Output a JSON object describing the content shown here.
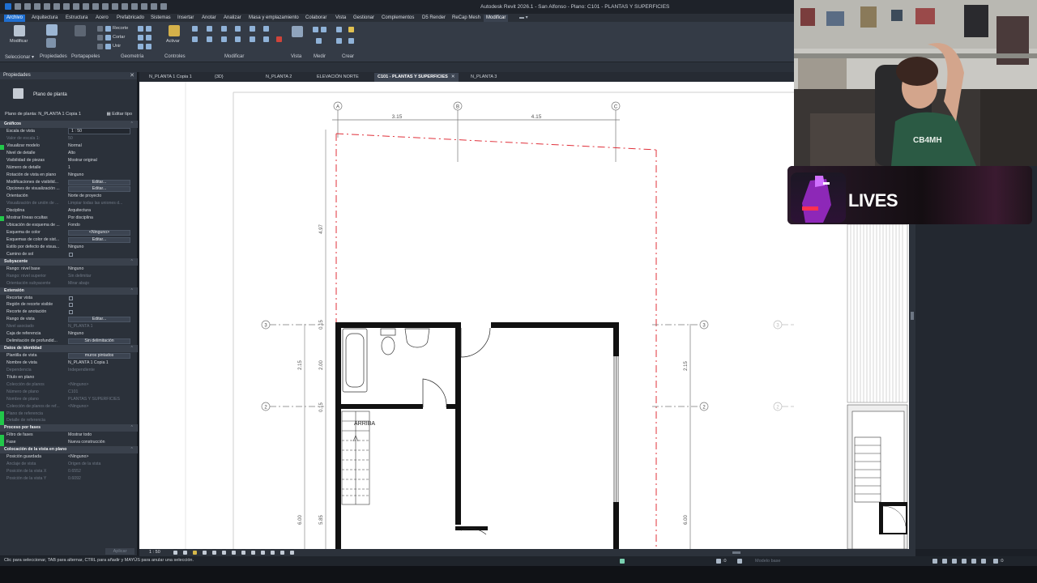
{
  "window": {
    "title": "Autodesk Revit 2026.1 - San Alfonso - Plano: C101 - PLANTAS Y SUPERFICIES"
  },
  "menu": {
    "items": [
      "Archivo",
      "Arquitectura",
      "Estructura",
      "Acero",
      "Prefabricado",
      "Sistemas",
      "Insertar",
      "Anotar",
      "Analizar",
      "Masa y emplazamiento",
      "Colaborar",
      "Vista",
      "Gestionar",
      "Complementos",
      "D5 Render",
      "ReCap Mesh",
      "Modificar"
    ]
  },
  "ribbon": {
    "groups": [
      "Seleccionar",
      "Propiedades",
      "Portapapeles",
      "Geometría",
      "Controles",
      "Modificar",
      "Vista",
      "Medir",
      "Crear"
    ],
    "buttons": {
      "modify": "Modificar",
      "activate": "Activar",
      "cope": "Recorte",
      "cut": "Cortar",
      "join": "Unir"
    }
  },
  "properties": {
    "title": "Propiedades",
    "type_name": "Plano de planta",
    "instance_label": "Plano de planta: N_PLANTA 1 Copia 1",
    "edit_type": "Editar tipo",
    "rows": [
      {
        "kind": "section",
        "name": "Gráficos"
      },
      {
        "name": "Escala de vista",
        "value": "1 : 50",
        "ctl": "box"
      },
      {
        "name": "Valor de escala   1:",
        "value": "50",
        "dim": true
      },
      {
        "name": "Visualizar modelo",
        "value": "Normal"
      },
      {
        "name": "Nivel de detalle",
        "value": "Alto"
      },
      {
        "name": "Visibilidad de piezas",
        "value": "Mostrar original"
      },
      {
        "name": "Número de detalle",
        "value": "1"
      },
      {
        "name": "Rotación de vista en plano",
        "value": "Ninguno"
      },
      {
        "name": "Modificaciones de visibilid...",
        "value": "Editar...",
        "ctl": "btn"
      },
      {
        "name": "Opciones de visualización ...",
        "value": "Editar...",
        "ctl": "btn"
      },
      {
        "name": "Orientación",
        "value": "Norte de proyecto"
      },
      {
        "name": "Visualización de unión de ...",
        "value": "Limpiar todas las uniones d...",
        "dim": true
      },
      {
        "name": "Disciplina",
        "value": "Arquitectura"
      },
      {
        "name": "Mostrar líneas ocultas",
        "value": "Por disciplina"
      },
      {
        "name": "Ubicación de esquema de ...",
        "value": "Fondo"
      },
      {
        "name": "Esquema de color",
        "value": "<Ninguno>",
        "ctl": "btn"
      },
      {
        "name": "Esquemas de color de sist...",
        "value": "Editar...",
        "ctl": "btn"
      },
      {
        "name": "Estilo por defecto de visua...",
        "value": "Ninguno"
      },
      {
        "name": "Camino de sol",
        "value": "",
        "ctl": "check"
      },
      {
        "kind": "section",
        "name": "Subyacente"
      },
      {
        "name": "Rango: nivel base",
        "value": "Ninguno"
      },
      {
        "name": "Rango: nivel superior",
        "value": "Sin delimitar",
        "dim": true
      },
      {
        "name": "Orientación subyacente",
        "value": "Mirar abajo",
        "dim": true
      },
      {
        "kind": "section",
        "name": "Extensión"
      },
      {
        "name": "Recortar vista",
        "value": "",
        "ctl": "check"
      },
      {
        "name": "Región de recorte visible",
        "value": "",
        "ctl": "check"
      },
      {
        "name": "Recorte de anotación",
        "value": "",
        "ctl": "check"
      },
      {
        "name": "Rango de vista",
        "value": "Editar...",
        "ctl": "btn"
      },
      {
        "name": "Nivel asociado",
        "value": "N_PLANTA 1",
        "dim": true
      },
      {
        "name": "Caja de referencia",
        "value": "Ninguno"
      },
      {
        "name": "Delimitación de profundid...",
        "value": "Sin delimitación",
        "ctl": "btn"
      },
      {
        "kind": "section",
        "name": "Datos de identidad"
      },
      {
        "name": "Plantilla de vista",
        "value": "muros pintados",
        "ctl": "btn"
      },
      {
        "name": "Nombre de vista",
        "value": "N_PLANTA 1 Copia 1"
      },
      {
        "name": "Dependencia",
        "value": "Independiente",
        "dim": true
      },
      {
        "name": "Título en plano",
        "value": ""
      },
      {
        "name": "Colección de planos",
        "value": "<Ninguno>",
        "dim": true
      },
      {
        "name": "Número de plano",
        "value": "C101",
        "dim": true
      },
      {
        "name": "Nombre de plano",
        "value": "PLANTAS Y SUPERFICIES",
        "dim": true
      },
      {
        "name": "Colección de planos de ref...",
        "value": "<Ninguno>",
        "dim": true
      },
      {
        "name": "Plano de referencia",
        "value": "",
        "dim": true
      },
      {
        "name": "Detalle de referencia",
        "value": "",
        "dim": true
      },
      {
        "kind": "section",
        "name": "Proceso por fases"
      },
      {
        "name": "Filtro de fases",
        "value": "Mostrar todo"
      },
      {
        "name": "Fase",
        "value": "Nueva construcción"
      },
      {
        "kind": "section",
        "name": "Colocación de la vista en plano"
      },
      {
        "name": "Posición guardada",
        "value": "<Ninguno>"
      },
      {
        "name": "Anclaje de vista",
        "value": "Origen de la vista",
        "dim": true
      },
      {
        "name": "Posición de la vista X",
        "value": "0.6552",
        "dim": true
      },
      {
        "name": "Posición de la vista Y",
        "value": "0.6092",
        "dim": true
      }
    ],
    "apply": "Aplicar"
  },
  "tabs": [
    {
      "label": "N_PLANTA 1 Copia 1",
      "active": false
    },
    {
      "label": "{3D}",
      "active": false
    },
    {
      "label": "N_PLANTA 2",
      "active": false
    },
    {
      "label": "ELEVACIÓN NORTE",
      "active": false
    },
    {
      "label": "C101 - PLANTAS Y SUPERFICIES",
      "active": true
    },
    {
      "label": "N_PLANTA 3",
      "active": false
    }
  ],
  "drawing": {
    "grids_top": [
      "A",
      "B",
      "C"
    ],
    "grids_side": [
      "3",
      "2"
    ],
    "dims_top": [
      "3.15",
      "4.15"
    ],
    "dims_left": [
      "4.97",
      "0.15",
      "2.15",
      "2.00",
      "0.15",
      "6.00",
      "5.85"
    ],
    "dims_right": [
      "2.15",
      "6.00"
    ],
    "stair_label": "ARRIBA"
  },
  "viewbar": {
    "scale": "1 : 50"
  },
  "status": {
    "message": "Clic para seleccionar, TAB para alternar, CTRL para añadir y MAYÚS para anular una selección.",
    "zero1": ":0",
    "model": "Modelo base",
    "zero2": ":0"
  },
  "overlay": {
    "lives": "LIVES"
  },
  "colors": {
    "accent": "#1f6fd1",
    "crop_red": "#e0303a",
    "panel": "#2b313a",
    "status_green": "#22c84a"
  }
}
